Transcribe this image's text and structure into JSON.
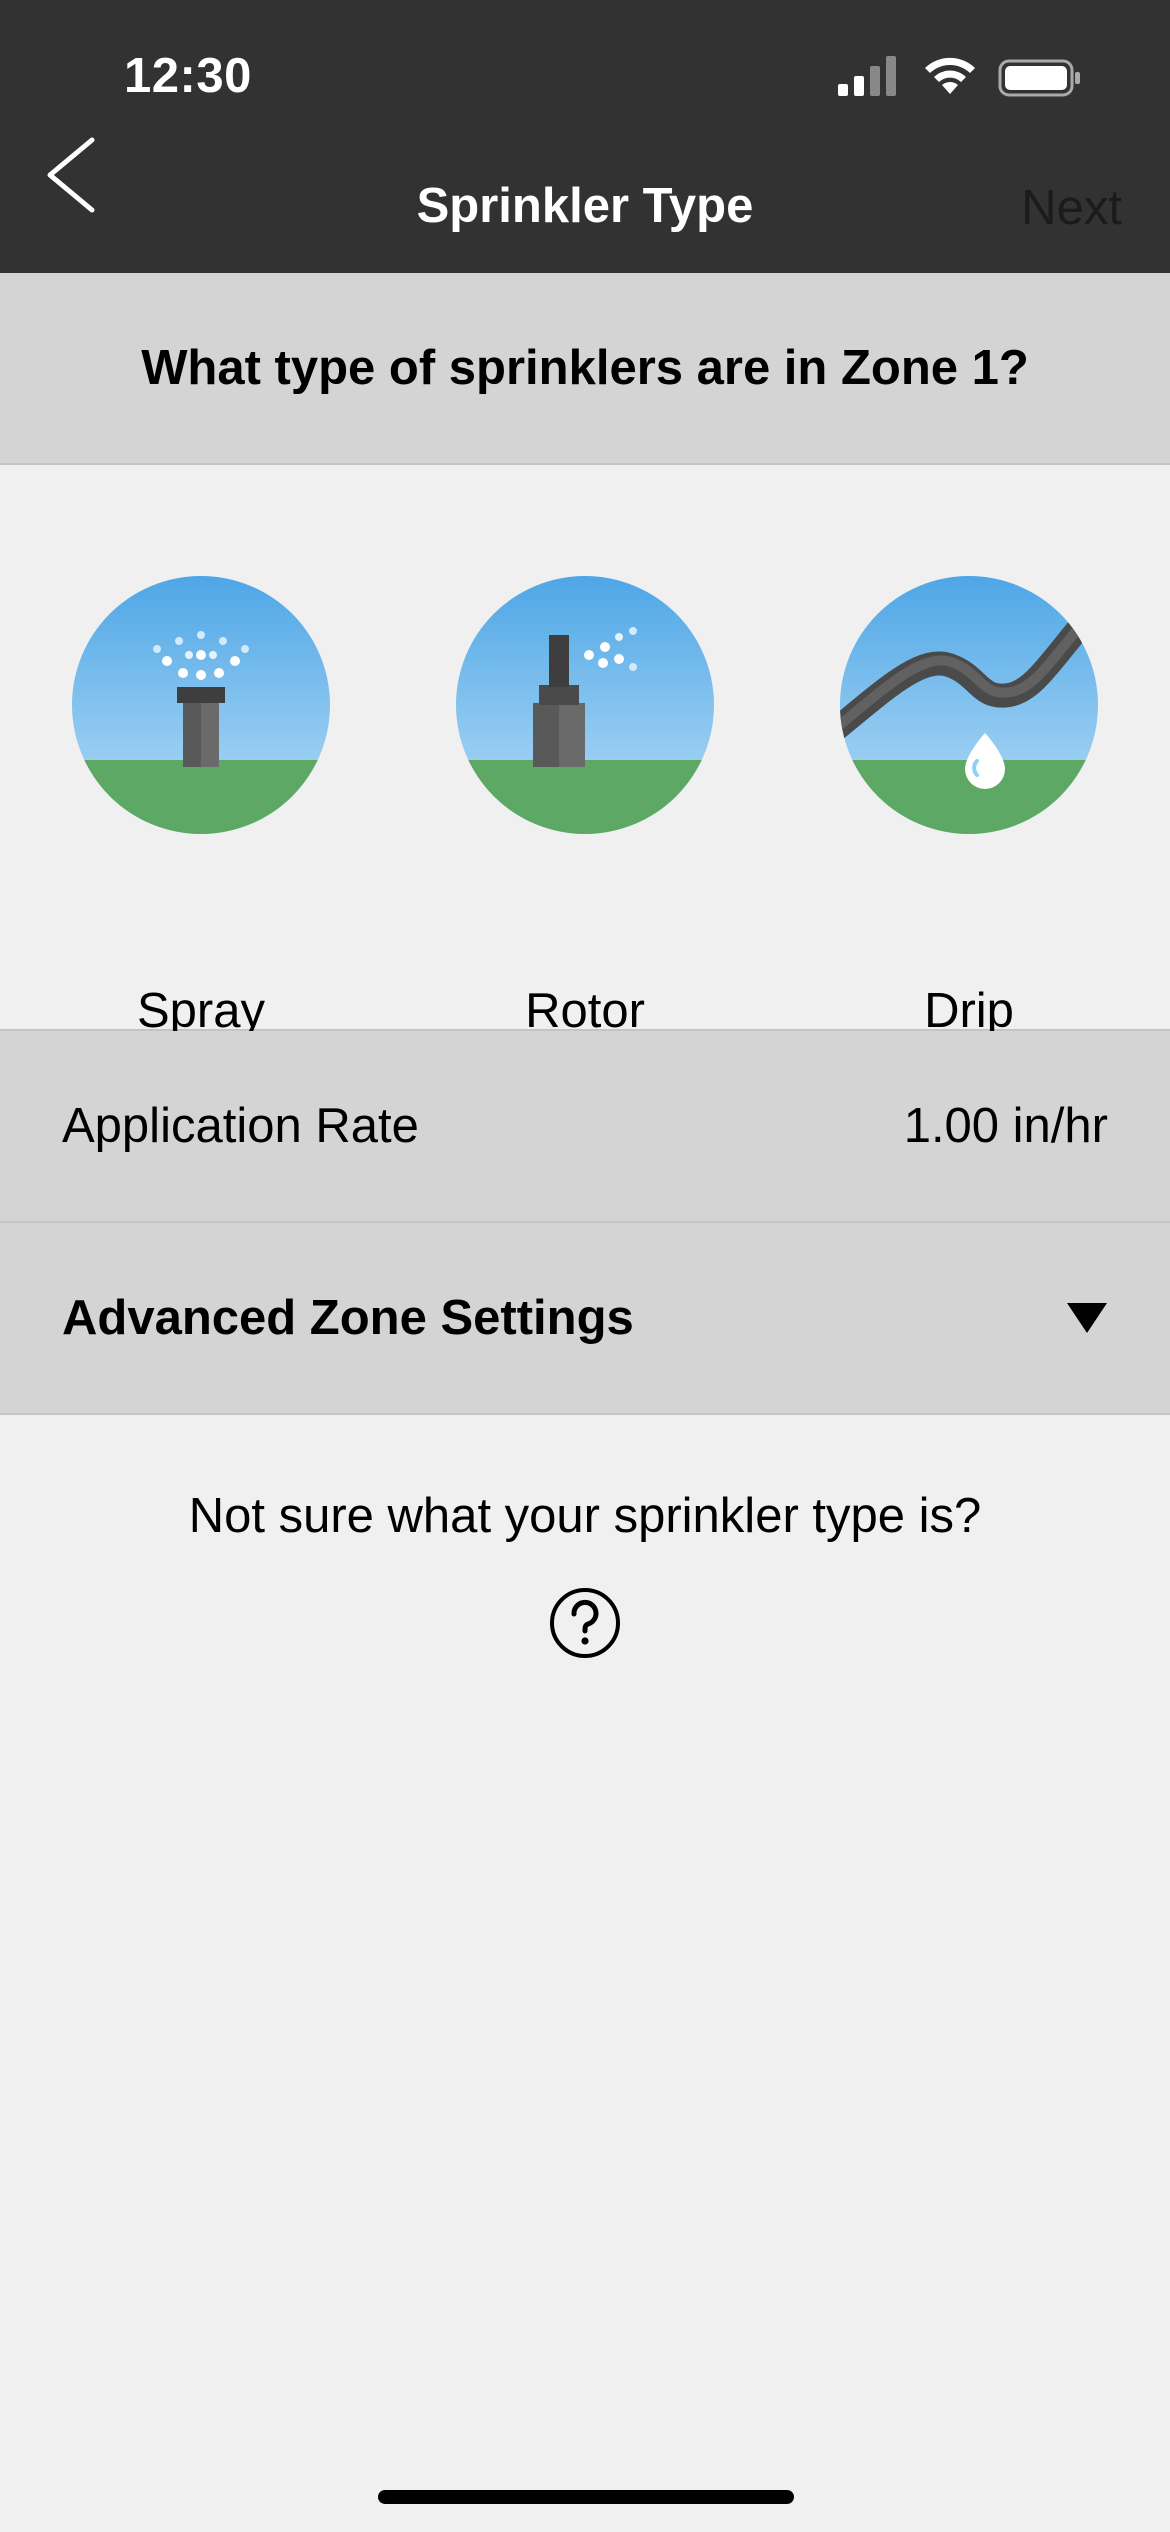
{
  "status_bar": {
    "time": "12:30"
  },
  "nav": {
    "title": "Sprinkler Type",
    "next_label": "Next"
  },
  "question": "What type of sprinklers are in Zone 1?",
  "sprinkler_types": [
    {
      "label": "Spray",
      "icon": "spray-sprinkler-icon"
    },
    {
      "label": "Rotor",
      "icon": "rotor-sprinkler-icon"
    },
    {
      "label": "Drip",
      "icon": "drip-line-icon"
    }
  ],
  "application_rate": {
    "label": "Application Rate",
    "value": "1.00 in/hr"
  },
  "advanced": {
    "label": "Advanced Zone Settings"
  },
  "help": {
    "text": "Not sure what your sprinkler type is?",
    "icon": "question-circle-icon"
  },
  "colors": {
    "header": "#323232",
    "section": "#d4d4d4",
    "background": "#f0f0f0",
    "sky": "#5aaee8",
    "grass": "#5ca864",
    "body": "#595959"
  }
}
